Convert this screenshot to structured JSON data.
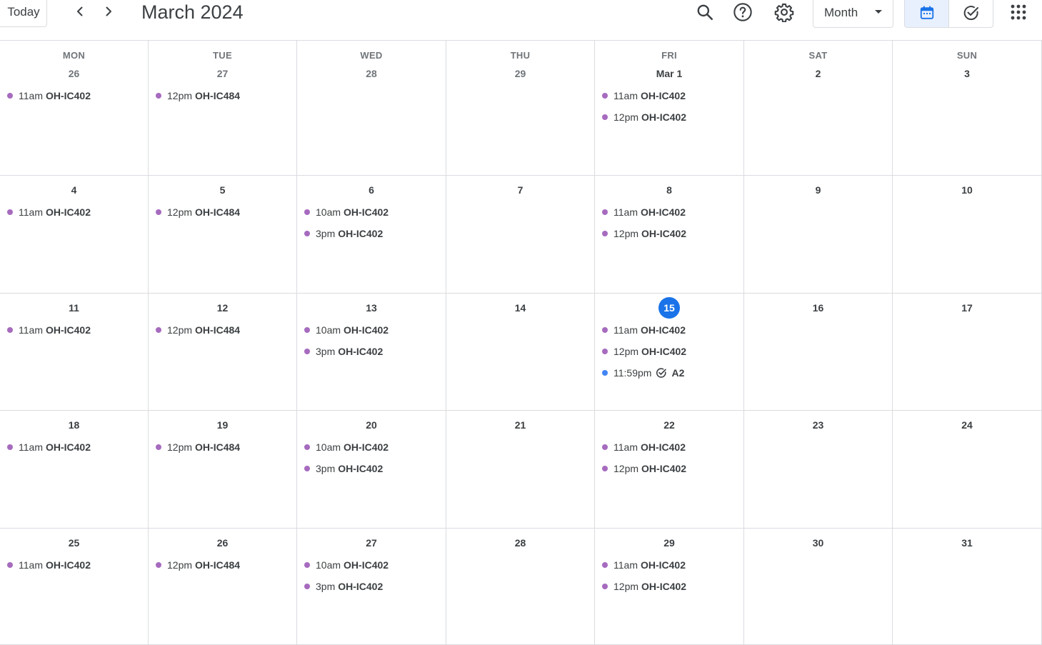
{
  "header": {
    "today_label": "Today",
    "prev_icon": "chevron-left-icon",
    "next_icon": "chevron-right-icon",
    "title": "March 2024",
    "search_icon": "search-icon",
    "help_icon": "help-icon",
    "settings_icon": "gear-icon",
    "view_label": "Month",
    "calendar_view_icon": "calendar-icon",
    "tasks_view_icon": "task-check-icon",
    "apps_icon": "apps-grid-icon"
  },
  "colors": {
    "event_dot": "#a66bbe",
    "task_dot": "#4285f4",
    "today_circle": "#1a73e8",
    "active_toggle_bg": "#e8f0fe"
  },
  "days_of_week": [
    "MON",
    "TUE",
    "WED",
    "THU",
    "FRI",
    "SAT",
    "SUN"
  ],
  "weeks": [
    {
      "days": [
        {
          "label": "26",
          "muted": true,
          "events": [
            {
              "time": "11am",
              "name": "OH-IC402"
            }
          ]
        },
        {
          "label": "27",
          "muted": true,
          "events": [
            {
              "time": "12pm",
              "name": "OH-IC484"
            }
          ]
        },
        {
          "label": "28",
          "muted": true,
          "events": []
        },
        {
          "label": "29",
          "muted": true,
          "events": []
        },
        {
          "label": "Mar 1",
          "events": [
            {
              "time": "11am",
              "name": "OH-IC402"
            },
            {
              "time": "12pm",
              "name": "OH-IC402"
            }
          ]
        },
        {
          "label": "2",
          "events": []
        },
        {
          "label": "3",
          "events": []
        }
      ]
    },
    {
      "days": [
        {
          "label": "4",
          "events": [
            {
              "time": "11am",
              "name": "OH-IC402"
            }
          ]
        },
        {
          "label": "5",
          "events": [
            {
              "time": "12pm",
              "name": "OH-IC484"
            }
          ]
        },
        {
          "label": "6",
          "events": [
            {
              "time": "10am",
              "name": "OH-IC402"
            },
            {
              "time": "3pm",
              "name": "OH-IC402"
            }
          ]
        },
        {
          "label": "7",
          "events": []
        },
        {
          "label": "8",
          "events": [
            {
              "time": "11am",
              "name": "OH-IC402"
            },
            {
              "time": "12pm",
              "name": "OH-IC402"
            }
          ]
        },
        {
          "label": "9",
          "events": []
        },
        {
          "label": "10",
          "events": []
        }
      ]
    },
    {
      "days": [
        {
          "label": "11",
          "events": [
            {
              "time": "11am",
              "name": "OH-IC402"
            }
          ]
        },
        {
          "label": "12",
          "events": [
            {
              "time": "12pm",
              "name": "OH-IC484"
            }
          ]
        },
        {
          "label": "13",
          "events": [
            {
              "time": "10am",
              "name": "OH-IC402"
            },
            {
              "time": "3pm",
              "name": "OH-IC402"
            }
          ]
        },
        {
          "label": "14",
          "events": []
        },
        {
          "label": "15",
          "today": true,
          "events": [
            {
              "time": "11am",
              "name": "OH-IC402"
            },
            {
              "time": "12pm",
              "name": "OH-IC402"
            },
            {
              "time": "11:59pm",
              "name": "A2",
              "task": true
            }
          ]
        },
        {
          "label": "16",
          "events": []
        },
        {
          "label": "17",
          "events": []
        }
      ]
    },
    {
      "days": [
        {
          "label": "18",
          "events": [
            {
              "time": "11am",
              "name": "OH-IC402"
            }
          ]
        },
        {
          "label": "19",
          "events": [
            {
              "time": "12pm",
              "name": "OH-IC484"
            }
          ]
        },
        {
          "label": "20",
          "events": [
            {
              "time": "10am",
              "name": "OH-IC402"
            },
            {
              "time": "3pm",
              "name": "OH-IC402"
            }
          ]
        },
        {
          "label": "21",
          "events": []
        },
        {
          "label": "22",
          "events": [
            {
              "time": "11am",
              "name": "OH-IC402"
            },
            {
              "time": "12pm",
              "name": "OH-IC402"
            }
          ]
        },
        {
          "label": "23",
          "events": []
        },
        {
          "label": "24",
          "events": []
        }
      ]
    },
    {
      "days": [
        {
          "label": "25",
          "events": [
            {
              "time": "11am",
              "name": "OH-IC402"
            }
          ]
        },
        {
          "label": "26",
          "events": [
            {
              "time": "12pm",
              "name": "OH-IC484"
            }
          ]
        },
        {
          "label": "27",
          "events": [
            {
              "time": "10am",
              "name": "OH-IC402"
            },
            {
              "time": "3pm",
              "name": "OH-IC402"
            }
          ]
        },
        {
          "label": "28",
          "events": []
        },
        {
          "label": "29",
          "events": [
            {
              "time": "11am",
              "name": "OH-IC402"
            },
            {
              "time": "12pm",
              "name": "OH-IC402"
            }
          ]
        },
        {
          "label": "30",
          "events": []
        },
        {
          "label": "31",
          "events": []
        }
      ]
    }
  ]
}
